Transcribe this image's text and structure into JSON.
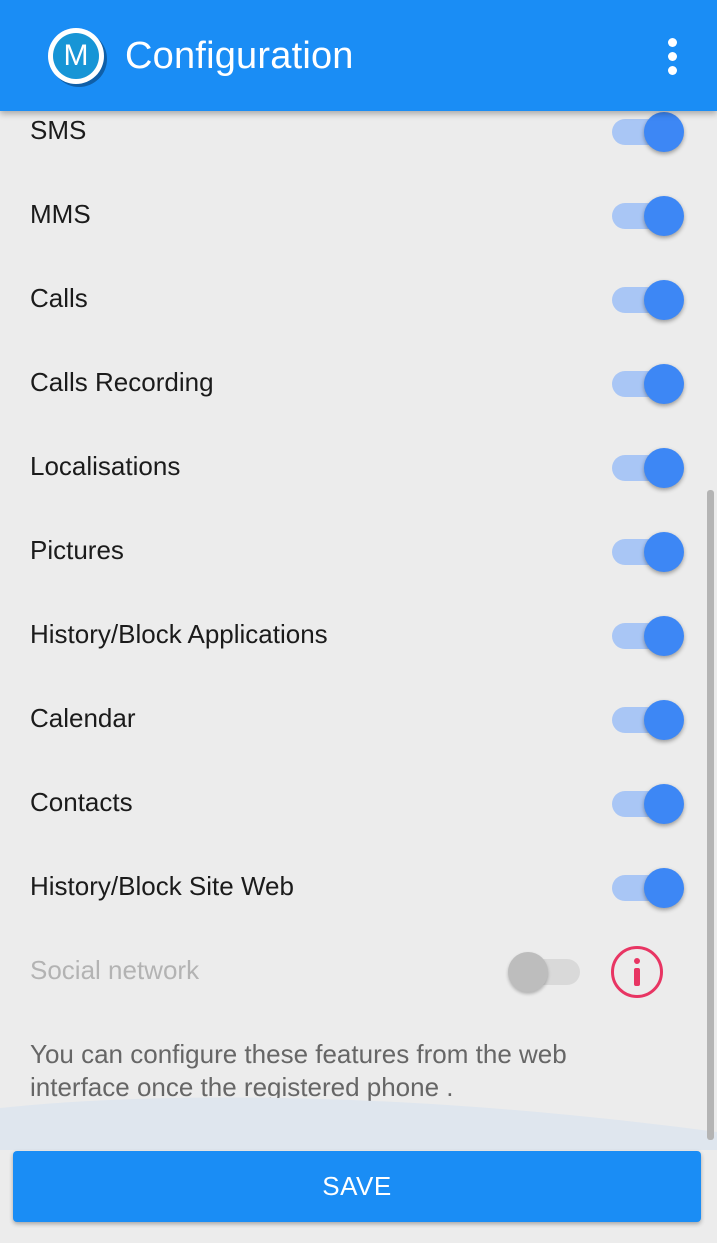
{
  "app": {
    "logo_letter": "M",
    "title": "Configuration",
    "menu_icon": "more-vert-icon"
  },
  "colors": {
    "primary": "#1a8df5",
    "switch_on_thumb": "#3d87f5",
    "switch_on_track": "#a9c6f5",
    "switch_off_thumb": "#bdbdbd",
    "info_icon": "#e83563"
  },
  "settings": [
    {
      "label": "SMS",
      "enabled": true
    },
    {
      "label": "MMS",
      "enabled": true
    },
    {
      "label": "Calls",
      "enabled": true
    },
    {
      "label": "Calls Recording",
      "enabled": true
    },
    {
      "label": "Localisations",
      "enabled": true
    },
    {
      "label": "Pictures",
      "enabled": true
    },
    {
      "label": "History/Block Applications",
      "enabled": true
    },
    {
      "label": "Calendar",
      "enabled": true
    },
    {
      "label": "Contacts",
      "enabled": true
    },
    {
      "label": "History/Block Site Web",
      "enabled": true
    },
    {
      "label": "Social network",
      "enabled": false,
      "disabled": true,
      "icon": "info-icon"
    }
  ],
  "info_text": "You can configure these features from the web interface once the registered phone .",
  "save_label": "SAVE"
}
